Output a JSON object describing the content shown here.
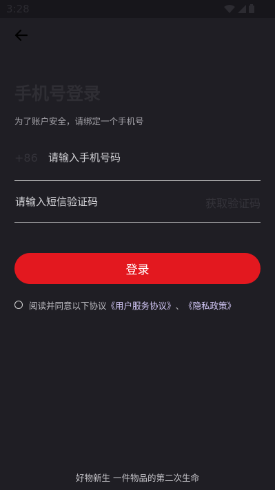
{
  "status_bar": {
    "time": "3:28"
  },
  "icons": {
    "back": "arrow-left-icon",
    "wifi": "wifi-icon",
    "signal": "signal-icon",
    "battery": "battery-icon"
  },
  "header": {
    "title": "手机号登录",
    "subtitle": "为了账户安全，请绑定一个手机号"
  },
  "form": {
    "country_code": "+86",
    "phone_placeholder": "请输入手机号码",
    "phone_value": "",
    "code_placeholder": "请输入短信验证码",
    "code_value": "",
    "get_code_label": "获取验证码",
    "login_label": "登录"
  },
  "agreement": {
    "checked": false,
    "prefix": "阅读并同意以下协议",
    "user_agreement": "《用户服务协议》",
    "separator": "、",
    "privacy_policy": "《隐私政策》"
  },
  "footer": {
    "slogan": "好物新生 一件物品的第二次生命"
  },
  "colors": {
    "background": "#1f1e24",
    "accent": "#e3181f",
    "link": "#d1c6f5"
  }
}
